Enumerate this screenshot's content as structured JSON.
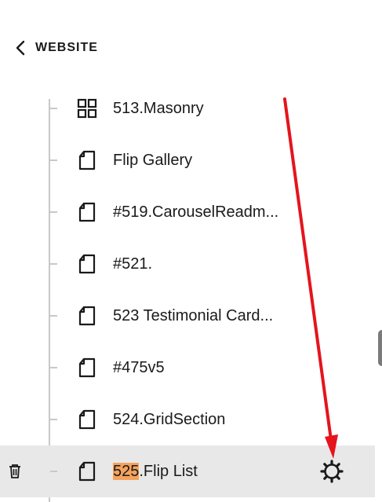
{
  "header": {
    "back_label": "WEBSITE",
    "back_icon": "chevron-left-icon"
  },
  "pages": [
    {
      "title": "513.Masonry",
      "icon": "grid-icon"
    },
    {
      "title": "Flip Gallery",
      "icon": "page-icon"
    },
    {
      "title": "#519.CarouselReadm...",
      "icon": "page-icon"
    },
    {
      "title": "#521.",
      "icon": "page-icon"
    },
    {
      "title": "523 Testimonial Card...",
      "icon": "page-icon"
    },
    {
      "title": "#475v5",
      "icon": "page-icon"
    },
    {
      "title": "524.GridSection",
      "icon": "page-icon"
    }
  ],
  "selected_page": {
    "title_highlight": "525",
    "title_rest": ".Flip List",
    "icon": "page-icon",
    "highlight_color": "#f5a25d",
    "actions": {
      "delete_icon": "trash-icon",
      "settings_icon": "gear-icon"
    }
  },
  "annotation_color": "#e5141d"
}
